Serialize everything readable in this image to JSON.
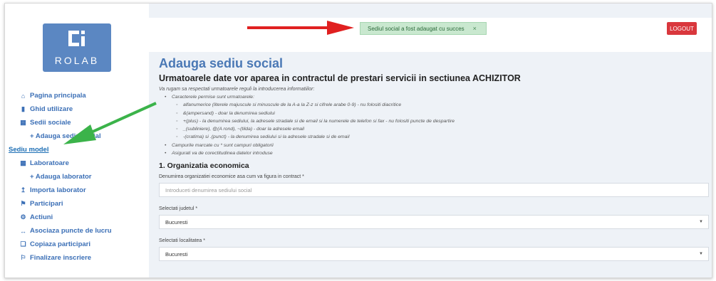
{
  "logo": {
    "text": "ROLAB",
    "color": "#5b87c2"
  },
  "sidebar": {
    "items": [
      {
        "label": "Pagina principala",
        "icon": "home-icon"
      },
      {
        "label": "Ghid utilizare",
        "icon": "book-icon"
      },
      {
        "label": "Sedii sociale",
        "icon": "building-icon"
      },
      {
        "label": "+ Adauga sediu social",
        "icon": ""
      },
      {
        "label": "Sediu model",
        "icon": ""
      },
      {
        "label": "Laboratoare",
        "icon": "lab-icon"
      },
      {
        "label": "+ Adauga laborator",
        "icon": ""
      },
      {
        "label": "Importa laborator",
        "icon": "upload-icon"
      },
      {
        "label": "Participari",
        "icon": "flag-icon"
      },
      {
        "label": "Actiuni",
        "icon": "gear-icon"
      },
      {
        "label": "Asociaza puncte de lucru",
        "icon": "link-icon"
      },
      {
        "label": "Copiaza participari",
        "icon": "copy-icon"
      },
      {
        "label": "Finalizare inscriere",
        "icon": "flag-icon"
      }
    ]
  },
  "toast": {
    "message": "Sediul social a fost adaugat cu succes",
    "close": "×"
  },
  "header": {
    "logout": "LOGOUT"
  },
  "main": {
    "title": "Adauga sediu social",
    "subtitle_prefix": "Urmatoarele date vor aparea in contractul de prestari servicii in sectiunea ",
    "subtitle_bold": "ACHIZITOR",
    "intro": "Va rugam sa respectati urmatoarele reguli la introducerea informatiilor:",
    "rules": [
      {
        "level": 1,
        "text": "Caracterele permise sunt urmatoarele:"
      },
      {
        "level": 2,
        "text": "alfanumerice (literele majuscule si minuscule de la A-a la Z-z si cifrele arabe 0-9) - nu folositi diacritice"
      },
      {
        "level": 2,
        "text": "&(ampersand) - doar la denumirea sediului"
      },
      {
        "level": 2,
        "text": "+(plus) - la denumirea sediului, la adresele stradale si de email si la numerele de telefon si fax - nu folositi puncte de despartire"
      },
      {
        "level": 2,
        "text": "_(subliniere), @(A rond), ~(tilda) - doar la adresele email"
      },
      {
        "level": 2,
        "text": "-(cratima) si .(punct) - la denumirea sediului si la adresele stradale si de email"
      },
      {
        "level": 1,
        "text": "Campurile marcate cu * sunt campuri obligatorii"
      },
      {
        "level": 1,
        "text": "Asigurati va de corectitudinea datelor introduse"
      }
    ],
    "section_title": "1. Organizatia economica",
    "org_label": "Denumirea organizatiei economice asa cum va figura in contract *",
    "org_placeholder": "Introduceti denumirea sediului social",
    "judet_label": "Selectati judetul *",
    "judet_value": "Bucuresti",
    "localitate_label": "Selectati localitatea *",
    "localitate_value": "Bucuresti"
  },
  "colors": {
    "accent": "#3b6fb6",
    "logout": "#d9373d",
    "toast_bg": "#c9e8cf",
    "arrow_red": "#e02020",
    "arrow_green": "#3bb34a"
  }
}
